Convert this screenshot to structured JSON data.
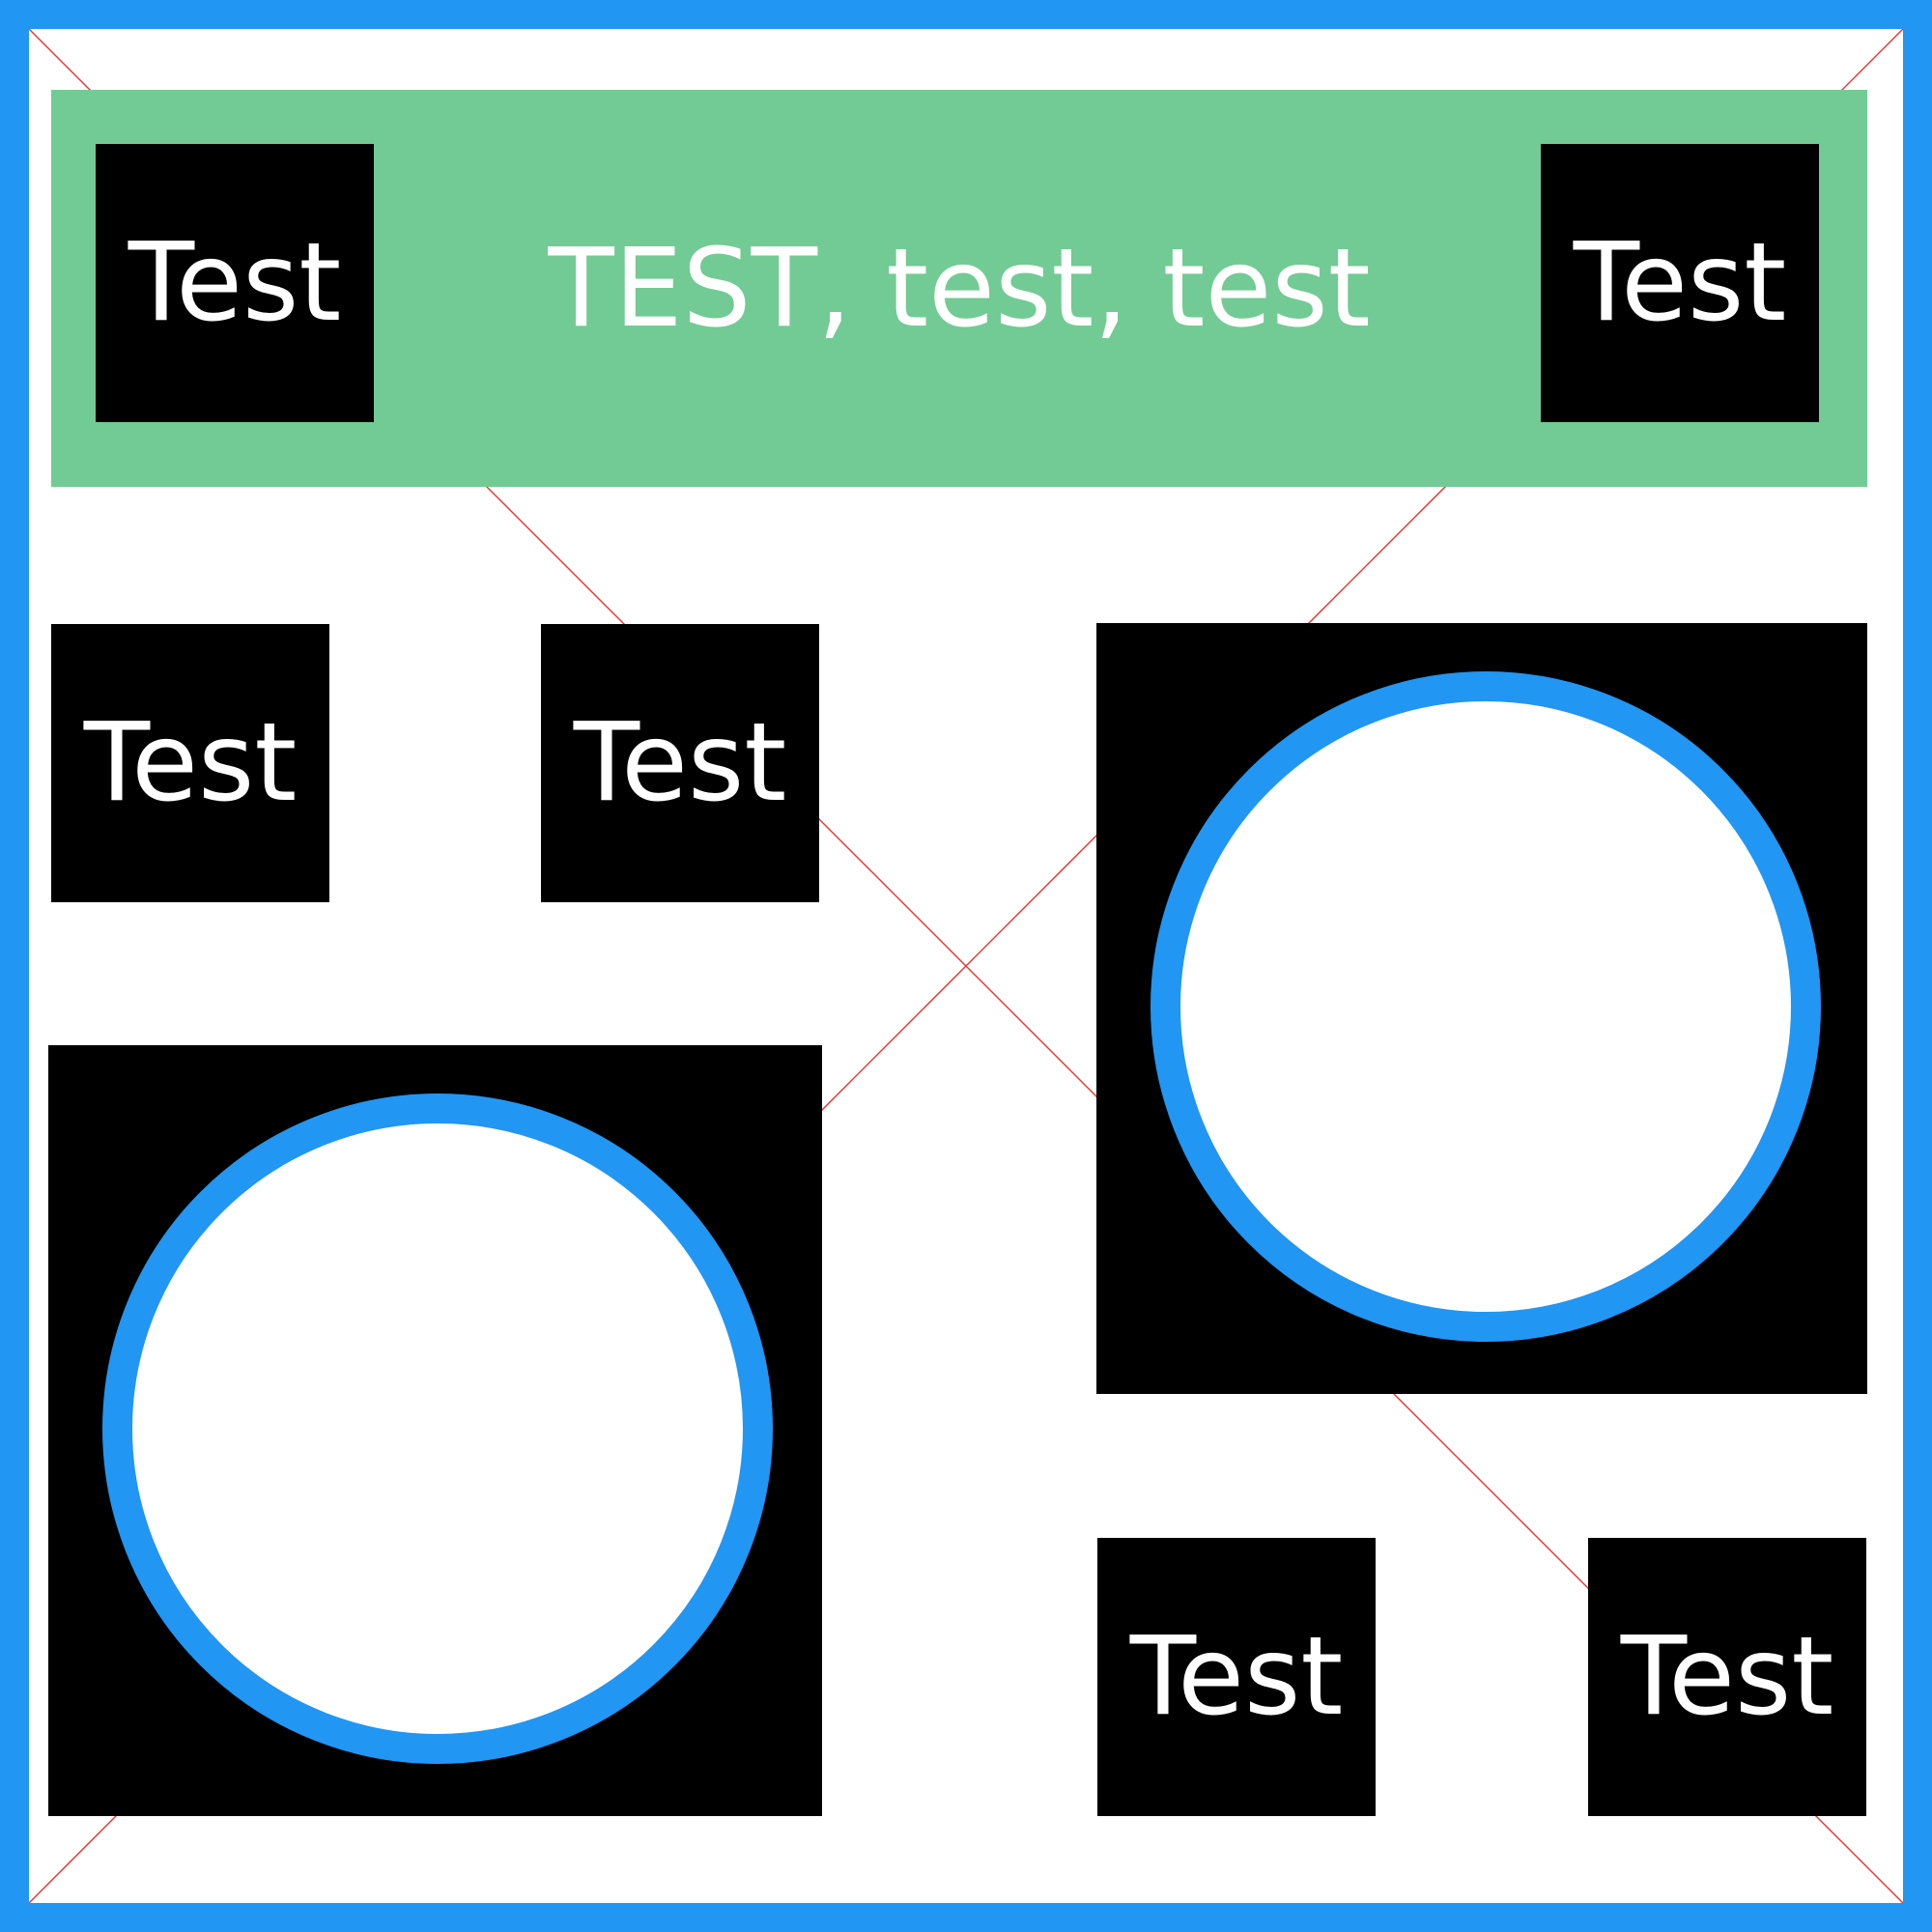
{
  "colors": {
    "frame_border": "#2196f3",
    "header_background": "#72cb94",
    "tile_background": "#000000",
    "ring_color": "#2196f3",
    "diagonal_lines": "#e53935"
  },
  "header": {
    "title": "TEST, test, test",
    "left_tile_label": "Test",
    "right_tile_label": "Test"
  },
  "tiles": [
    {
      "label": "Test"
    },
    {
      "label": "Test"
    },
    {
      "label": "Test"
    },
    {
      "label": "Test"
    }
  ]
}
